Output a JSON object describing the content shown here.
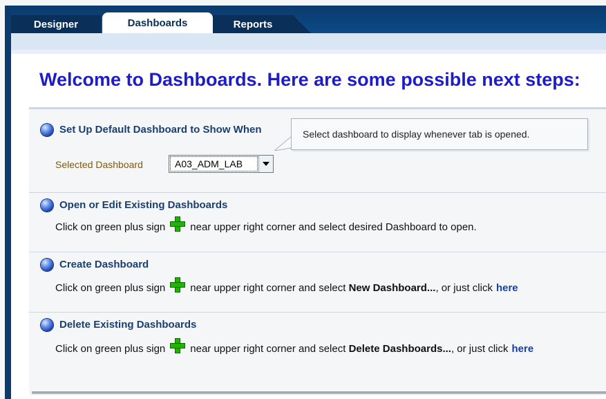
{
  "tabs": [
    {
      "label": "Designer"
    },
    {
      "label": "Dashboards"
    },
    {
      "label": "Reports"
    }
  ],
  "welcome": "Welcome to Dashboards.  Here are some possible next steps:",
  "sections": {
    "default": {
      "title": "Set Up Default Dashboard to Show When",
      "selected_label": "Selected Dashboard",
      "selected_value": "A03_ADM_LAB",
      "tooltip": "Select dashboard to display whenever tab is opened."
    },
    "open": {
      "title": "Open or Edit Existing Dashboards",
      "desc_pre": "Click on green plus sign",
      "desc_post": "near upper right corner and select desired Dashboard to open."
    },
    "create": {
      "title": "Create Dashboard",
      "desc_pre": "Click on green plus sign",
      "desc_mid": "near upper right corner and select",
      "desc_bold": "New Dashboard...",
      "desc_post": ", or just click",
      "link": "here"
    },
    "delete": {
      "title": "Delete Existing Dashboards",
      "desc_pre": "Click on green plus sign",
      "desc_mid": "near upper right corner and select",
      "desc_bold": "Delete Dashboards...",
      "desc_post": ", or just click",
      "link": "here"
    }
  },
  "icons": {
    "bullet": "blue-orb-icon",
    "plus": "green-plus-icon"
  },
  "colors": {
    "tab_dark": "#0a2f58",
    "heading_blue": "#1d1dc8",
    "section_title": "#1a3f6f",
    "plus_green": "#21b300"
  }
}
